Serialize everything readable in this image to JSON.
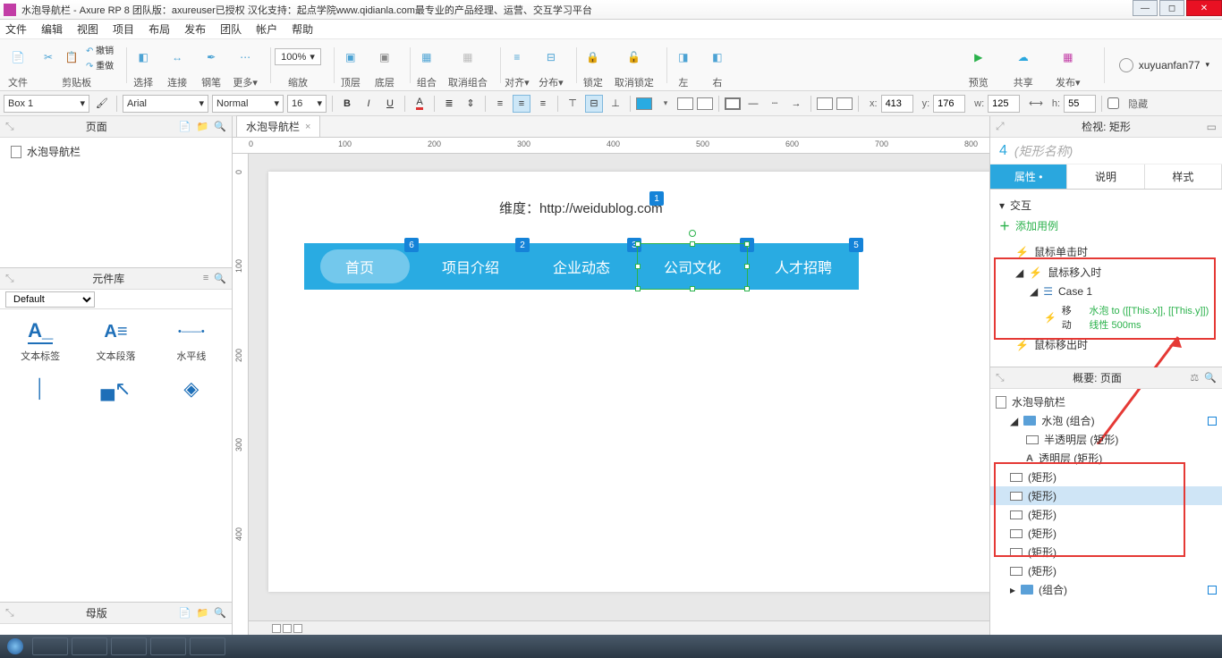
{
  "window": {
    "title": "水泡导航栏 - Axure RP 8 团队版：axureuser已授权 汉化支持：起点学院www.qidianla.com最专业的产品经理、运营、交互学习平台"
  },
  "menu": [
    "文件",
    "编辑",
    "视图",
    "项目",
    "布局",
    "发布",
    "团队",
    "帐户",
    "帮助"
  ],
  "toolbar": {
    "file": "文件",
    "clipboard": "剪贴板",
    "undo": "撤销",
    "redo": "重做",
    "select": "选择",
    "connect": "连接",
    "pen": "钢笔",
    "more": "更多▾",
    "zoom": "缩放",
    "zoom_value": "100%",
    "front": "顶层",
    "back": "底层",
    "group": "组合",
    "ungroup": "取消组合",
    "align": "对齐▾",
    "distribute": "分布▾",
    "lock": "锁定",
    "unlock": "取消锁定",
    "left": "左",
    "right": "右",
    "preview": "预览",
    "share": "共享",
    "publish": "发布▾",
    "user": "xuyuanfan77"
  },
  "formatbar": {
    "widget_style": "Box 1",
    "font": "Arial",
    "weight": "Normal",
    "size": "16",
    "x": "413",
    "y": "176",
    "w": "125",
    "h": "55",
    "hidden": "隐藏"
  },
  "panels": {
    "pages": "页面",
    "library": "元件库",
    "masters": "母版",
    "library_default": "Default"
  },
  "pages": {
    "page1": "水泡导航栏"
  },
  "widgets": {
    "label": "文本标签",
    "paragraph": "文本段落",
    "hline": "水平线"
  },
  "tab": {
    "name": "水泡导航栏"
  },
  "canvas": {
    "heading": "维度：http://weidublog.com",
    "nav": [
      "首页",
      "项目介绍",
      "企业动态",
      "公司文化",
      "人才招聘"
    ]
  },
  "inspector": {
    "title": "检视: 矩形",
    "index": "4",
    "placeholder": "(矩形名称)",
    "tab_props": "属性",
    "tab_notes": "说明",
    "tab_style": "样式",
    "section_int": "交互",
    "add_case": "添加用例",
    "on_click": "鼠标单击时",
    "on_enter": "鼠标移入时",
    "case1": "Case 1",
    "move_label": "移动",
    "move_target": "水泡 to ([[This.x]], [[This.y]]) 线性 500ms",
    "on_leave": "鼠标移出时"
  },
  "outline": {
    "title": "概要: 页面",
    "root": "水泡导航栏",
    "group1": "水泡 (组合)",
    "semi": "半透明层 (矩形)",
    "trans": "透明层 (矩形)",
    "rect": "(矩形)",
    "group2": "(组合)"
  }
}
